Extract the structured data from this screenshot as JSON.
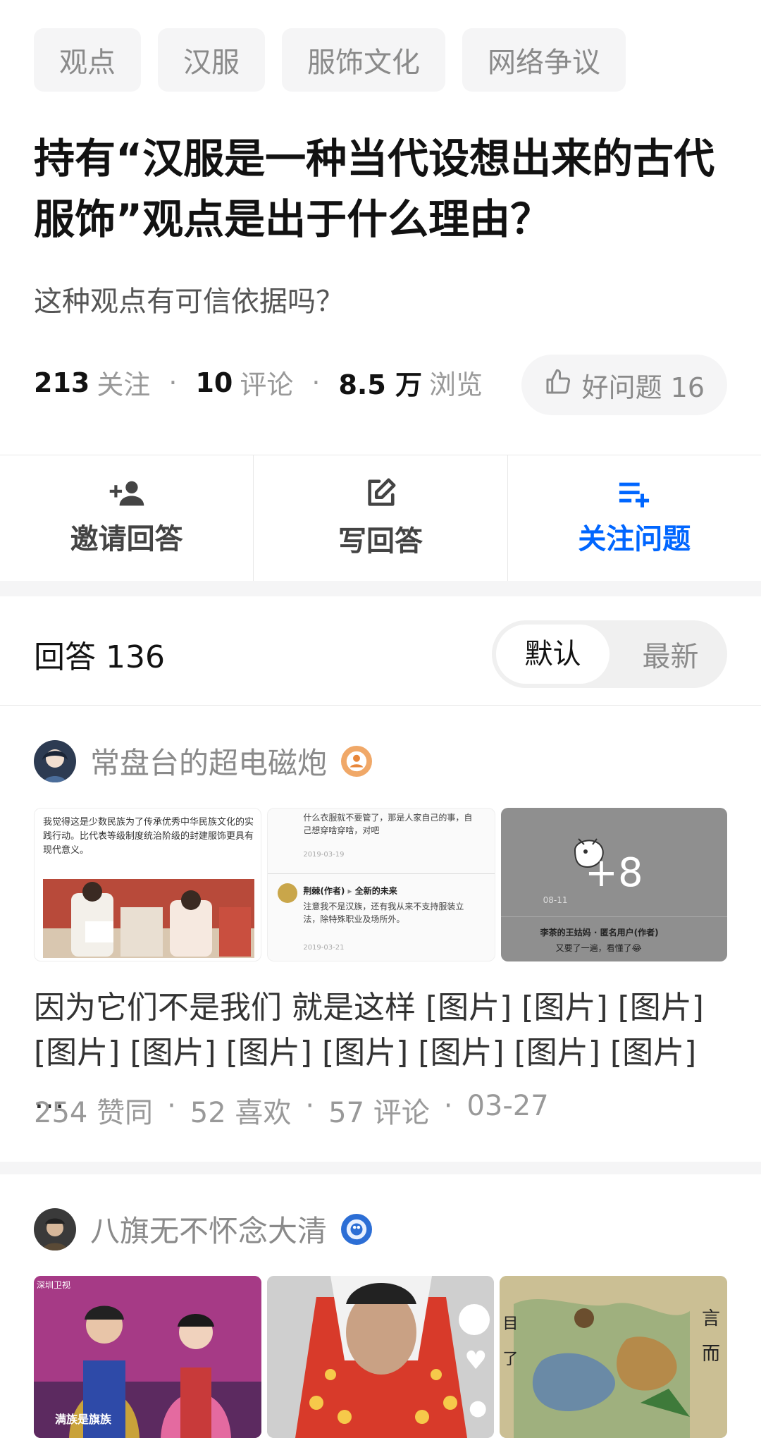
{
  "tags": [
    "观点",
    "汉服",
    "服饰文化",
    "网络争议"
  ],
  "question": {
    "title": "持有“汉服是一种当代设想出来的古代服饰”观点是出于什么理由？",
    "description": "这种观点有可信依据吗？",
    "followers": "213",
    "followers_label": "关注",
    "comments": "10",
    "comments_label": "评论",
    "views": "8.5 万",
    "views_label": "浏览",
    "good_question": "好问题 16"
  },
  "actions": {
    "invite": "邀请回答",
    "write": "写回答",
    "follow": "关注问题"
  },
  "answers": {
    "header": "回答 136",
    "sort_default": "默认",
    "sort_latest": "最新"
  },
  "answer1": {
    "author": "常盘台的超电磁炮",
    "thumb1_text": "我觉得这是少数民族为了传承优秀中华民族文化的实践行动。比代表等级制度统治阶级的封建服饰更具有现代意义。",
    "thumb2_top": "什么衣服就不要管了，那是人家自己的事，自己想穿啥穿啥，对吧",
    "thumb2_date1": "2019-03-19",
    "thumb2_user": "荆棘(作者)",
    "thumb2_reply": "全新的未来",
    "thumb2_body": "注意我不是汉族，还有我从来不支持服装立法，除特殊职业及场所外。",
    "thumb2_date2": "2019-03-21",
    "thumb3_more": "+8",
    "thumb3_date": "08-11",
    "thumb3_user": "李茶的王姑妈",
    "thumb3_anon": "匿名用户(作者)",
    "thumb3_body": "又要了一遍，看懂了😂",
    "excerpt": "因为它们不是我们 就是这样 [图片] [图片] [图片] [图片] [图片] [图片] [图片] [图片] [图片] [图片] …",
    "likes": "254 赞同",
    "favs": "52 喜欢",
    "comments": "57 评论",
    "date": "03-27"
  },
  "answer2": {
    "author": "八旗无不怀念大清",
    "thumb1_logo": "深圳卫视",
    "thumb1_caption": "满族是旗族",
    "thumb3_text1": "言",
    "thumb3_text2": "而",
    "thumb3_side1": "目",
    "thumb3_side2": "了"
  },
  "colors": {
    "accent": "#0066ff",
    "tag_bg": "#f5f5f6",
    "muted": "#8a8a8a"
  }
}
